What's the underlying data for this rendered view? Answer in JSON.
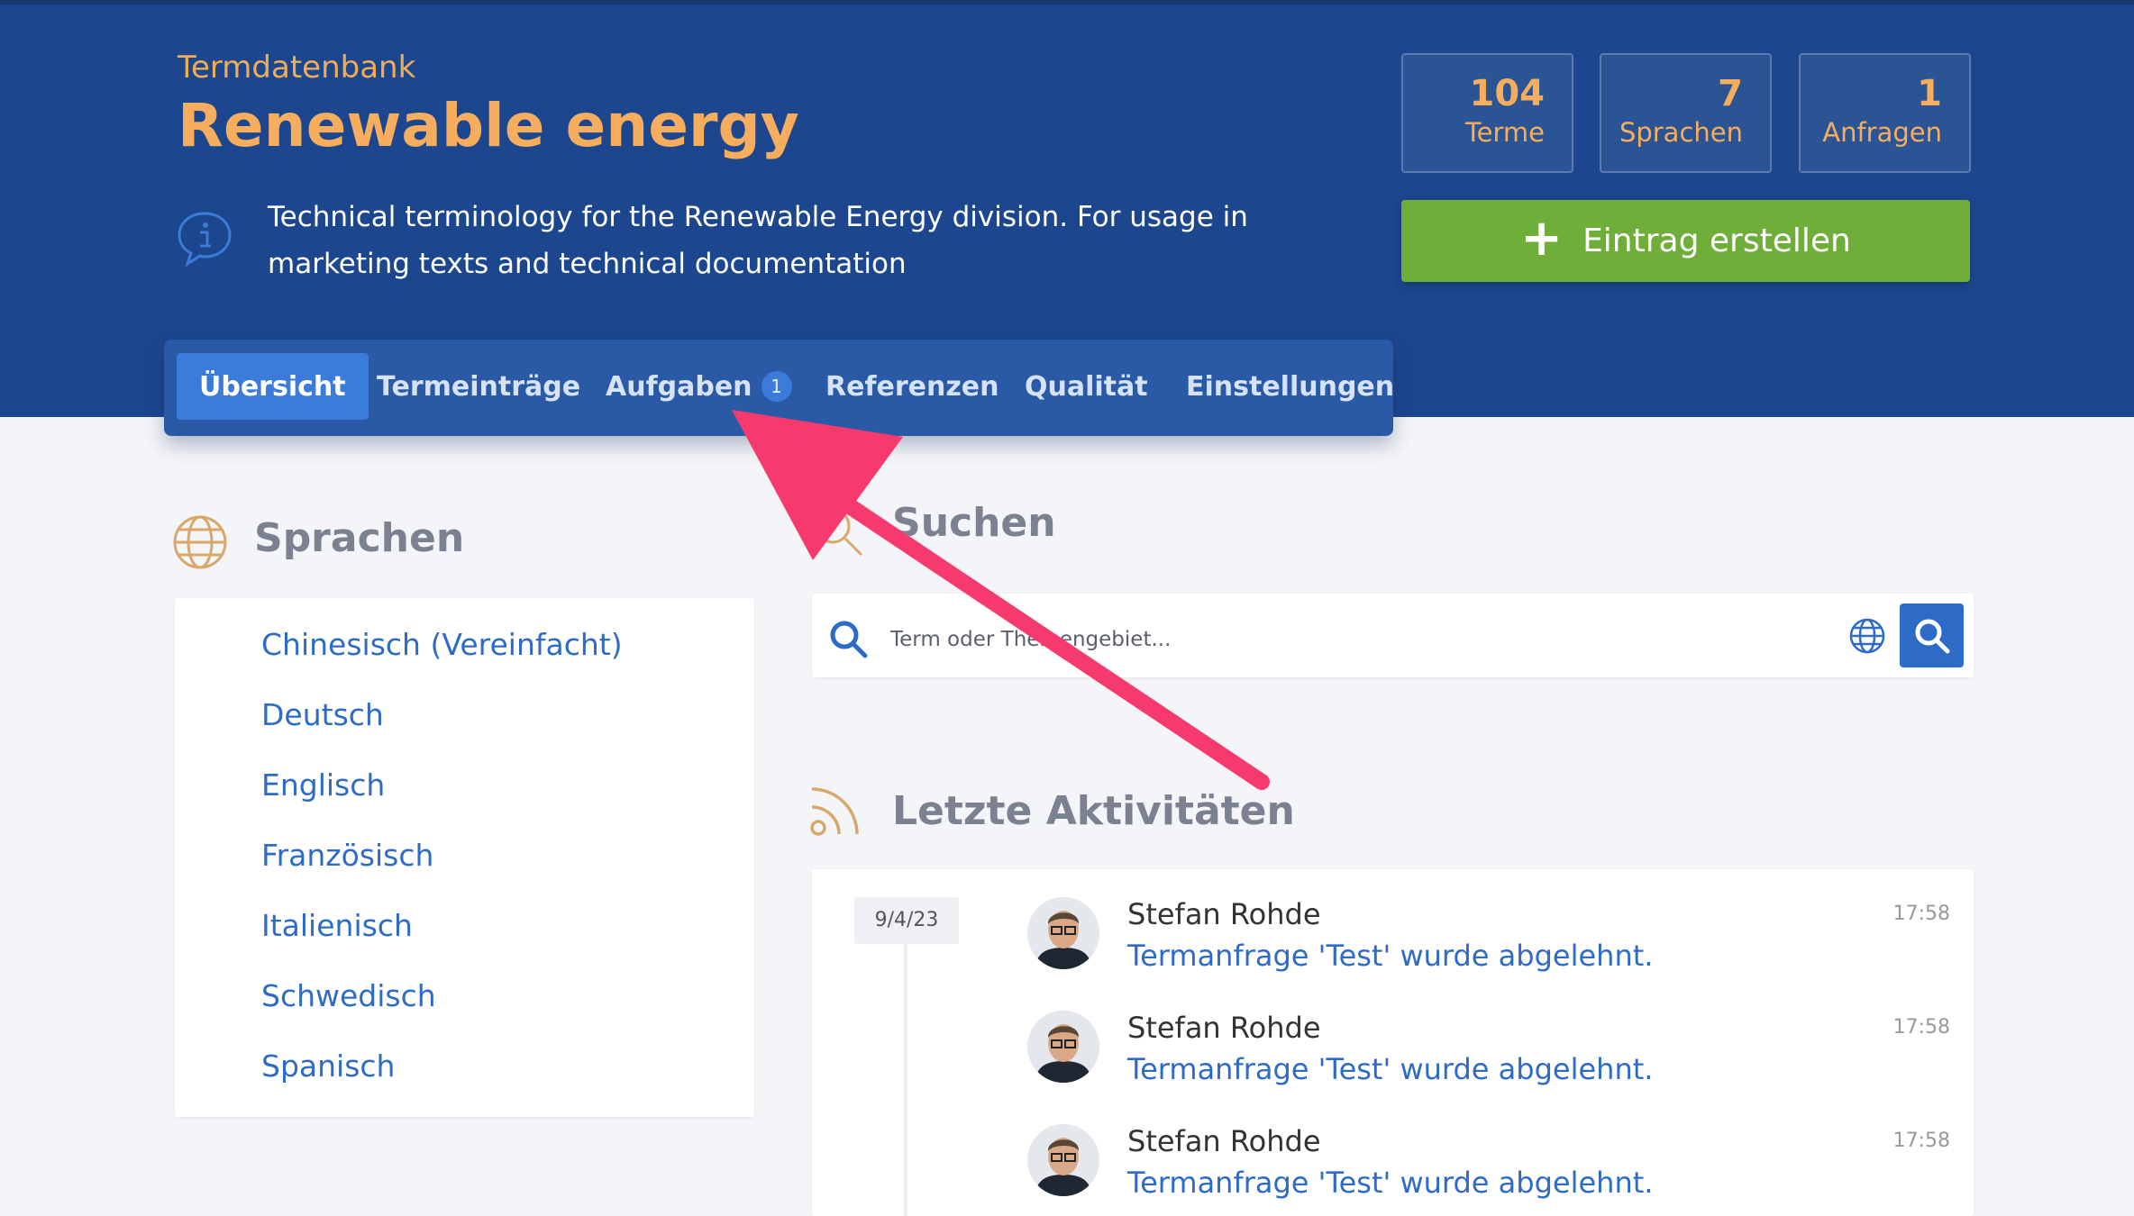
{
  "header": {
    "kicker": "Termdatenbank",
    "title": "Renewable energy",
    "description": "Technical terminology for the Renewable Energy division. For usage in marketing texts and technical documentation",
    "stats": [
      {
        "value": "104",
        "label": "Terme"
      },
      {
        "value": "7",
        "label": "Sprachen"
      },
      {
        "value": "1",
        "label": "Anfragen"
      }
    ],
    "create_button": "Eintrag erstellen"
  },
  "nav": {
    "tabs": [
      {
        "label": "Übersicht",
        "active": true
      },
      {
        "label": "Termeinträge"
      },
      {
        "label": "Aufgaben",
        "badge": "1"
      },
      {
        "label": "Referenzen"
      },
      {
        "label": "Qualität"
      },
      {
        "label": "Einstellungen"
      }
    ]
  },
  "languages": {
    "title": "Sprachen",
    "items": [
      "Chinesisch (Vereinfacht)",
      "Deutsch",
      "Englisch",
      "Französisch",
      "Italienisch",
      "Schwedisch",
      "Spanisch"
    ]
  },
  "search": {
    "title": "Suchen",
    "placeholder": "Term oder Themengebiet..."
  },
  "activity": {
    "title": "Letzte Aktivitäten",
    "date": "9/4/23",
    "items": [
      {
        "name": "Stefan Rohde",
        "text": "Termanfrage 'Test' wurde abgelehnt.",
        "time": "17:58"
      },
      {
        "name": "Stefan Rohde",
        "text": "Termanfrage 'Test' wurde abgelehnt.",
        "time": "17:58"
      },
      {
        "name": "Stefan Rohde",
        "text": "Termanfrage 'Test' wurde abgelehnt.",
        "time": "17:58"
      }
    ]
  },
  "colors": {
    "header_bg": "#1c468d",
    "accent_orange": "#f6ad5d",
    "create_green": "#6fae38",
    "link_blue": "#2e6bc6",
    "annotation_arrow": "#f73a6d"
  }
}
